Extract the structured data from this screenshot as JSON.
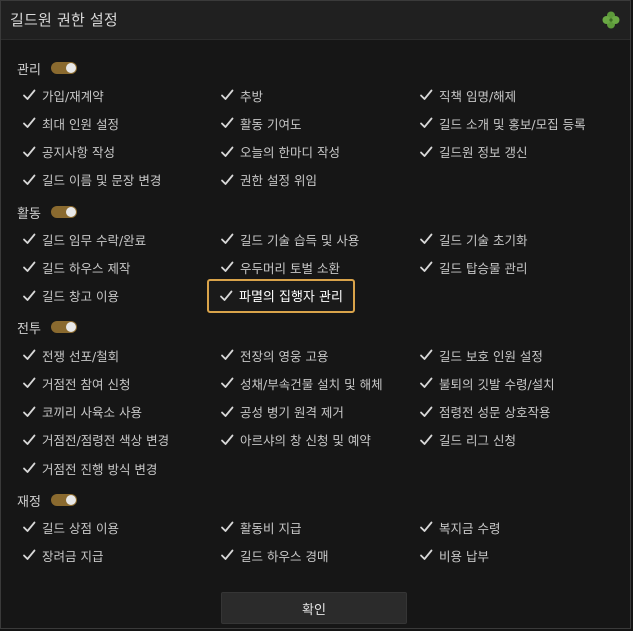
{
  "window": {
    "title": "길드원 권한 설정",
    "icon": "clover-icon"
  },
  "sections": [
    {
      "title": "관리",
      "toggle_on": true,
      "items": [
        {
          "label": "가입/재계약",
          "checked": true
        },
        {
          "label": "추방",
          "checked": true
        },
        {
          "label": "직책 임명/해제",
          "checked": true
        },
        {
          "label": "최대 인원 설정",
          "checked": true
        },
        {
          "label": "활동 기여도",
          "checked": true
        },
        {
          "label": "길드 소개 및 홍보/모집 등록",
          "checked": true
        },
        {
          "label": "공지사항 작성",
          "checked": true
        },
        {
          "label": "오늘의 한마디 작성",
          "checked": true
        },
        {
          "label": "길드원 정보 갱신",
          "checked": true
        },
        {
          "label": "길드 이름 및 문장 변경",
          "checked": true
        },
        {
          "label": "권한 설정 위임",
          "checked": true
        }
      ]
    },
    {
      "title": "활동",
      "toggle_on": true,
      "items": [
        {
          "label": "길드 임무 수락/완료",
          "checked": true
        },
        {
          "label": "길드 기술 습득 및 사용",
          "checked": true
        },
        {
          "label": "길드 기술 초기화",
          "checked": true
        },
        {
          "label": "길드 하우스 제작",
          "checked": true
        },
        {
          "label": "우두머리 토벌 소환",
          "checked": true
        },
        {
          "label": "길드 탑승물 관리",
          "checked": true
        },
        {
          "label": "길드 창고 이용",
          "checked": true
        },
        {
          "label": "파멸의 집행자 관리",
          "checked": true,
          "highlighted": true
        }
      ]
    },
    {
      "title": "전투",
      "toggle_on": true,
      "items": [
        {
          "label": "전쟁 선포/철회",
          "checked": true
        },
        {
          "label": "전장의 영웅 고용",
          "checked": true
        },
        {
          "label": "길드 보호 인원 설정",
          "checked": true
        },
        {
          "label": "거점전 참여 신청",
          "checked": true
        },
        {
          "label": "성채/부속건물 설치 및 해체",
          "checked": true
        },
        {
          "label": "불퇴의 깃발 수령/설치",
          "checked": true
        },
        {
          "label": "코끼리 사육소 사용",
          "checked": true
        },
        {
          "label": "공성 병기 원격 제거",
          "checked": true
        },
        {
          "label": "점령전 성문 상호작용",
          "checked": true
        },
        {
          "label": "거점전/점령전 색상 변경",
          "checked": true
        },
        {
          "label": "아르샤의 창 신청 및 예약",
          "checked": true
        },
        {
          "label": "길드 리그 신청",
          "checked": true
        },
        {
          "label": "거점전 진행 방식 변경",
          "checked": true
        }
      ]
    },
    {
      "title": "재정",
      "toggle_on": true,
      "items": [
        {
          "label": "길드 상점 이용",
          "checked": true
        },
        {
          "label": "활동비 지급",
          "checked": true
        },
        {
          "label": "복지금 수령",
          "checked": true
        },
        {
          "label": "장려금 지급",
          "checked": true
        },
        {
          "label": "길드 하우스 경매",
          "checked": true
        },
        {
          "label": "비용 납부",
          "checked": true
        }
      ]
    }
  ],
  "buttons": {
    "confirm": "확인"
  },
  "colors": {
    "accent": "#d9a34a",
    "toggle": "#8a6a2f",
    "check": "#d8d8d8"
  }
}
